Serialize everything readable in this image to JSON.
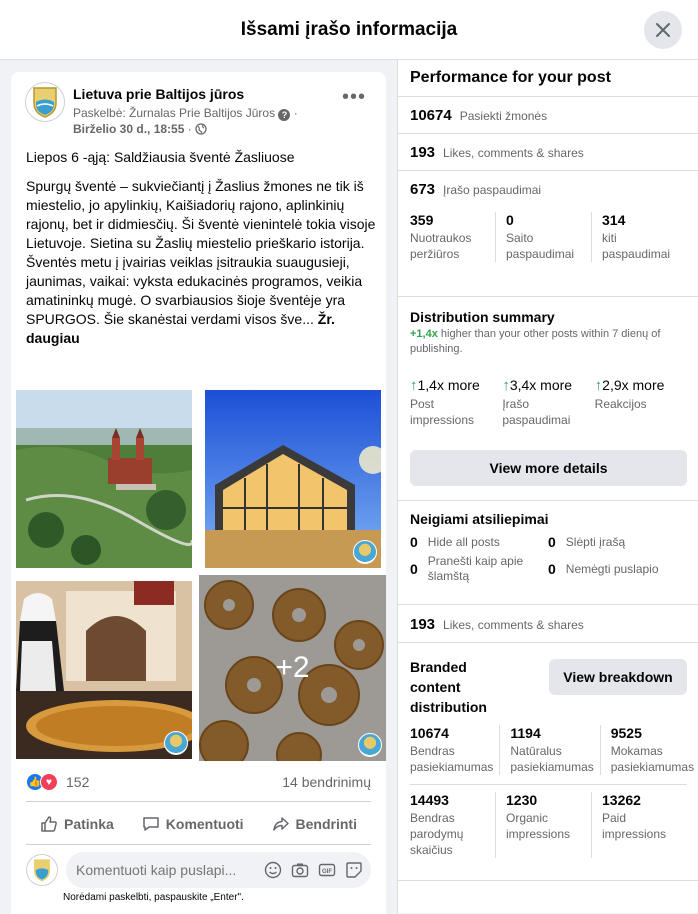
{
  "header": {
    "title": "Išsami įrašo informacija"
  },
  "post": {
    "page_name": "Lietuva prie Baltijos jūros",
    "posted_by": "Paskelbė: Žurnalas Prie Baltijos Jūros",
    "date": "Birželio 30 d., 18:55",
    "text_title": "Liepos 6 -ąją: Saldžiausia šventė Žasliuose",
    "text_body_1": "Spurgų šventė – sukviečiantį į Žaslius žmones ne tik iš miestelio, jo apylinkių, Kaišiadorių rajono, aplinkinių rajonų, bet ir didmiesčių. Ši šventė vienintelė tokia visoje Lietuvoje. Sietina su Žaslių miestelio prieškario istorija.",
    "text_body_2": "Šventės metu į įvairias veiklas įsitraukia suaugusieji, jaunimas, vaikai: vyksta edukacinės programos, veikia amatininkų mugė.  O svarbiausios šioje šventėje yra SPURGOS. Šie skanėstai verdami visos švе...",
    "see_more": "Žr. daugiau",
    "more_photos": "+2",
    "reaction_count": "152",
    "shares": "14 bendrinimų",
    "actions": {
      "like": "Patinka",
      "comment": "Komentuoti",
      "share": "Bendrinti"
    },
    "comment_placeholder": "Komentuoti kaip puslapi...",
    "comment_hint": "Norėdami paskelbti, paspauskite „Enter\"."
  },
  "performance": {
    "title": "Performance for your post",
    "reach": {
      "value": "10674",
      "label": "Pasiekti žmonės"
    },
    "engagement": {
      "value": "193",
      "label": "Likes, comments & shares"
    },
    "clicks": {
      "value": "673",
      "label": "Įrašo paspaudimai"
    },
    "click_breakdown": [
      {
        "value": "359",
        "label": "Nuotraukos peržiūros"
      },
      {
        "value": "0",
        "label": "Saito paspaudimai"
      },
      {
        "value": "314",
        "label": "kiti paspaudimai"
      }
    ]
  },
  "distribution": {
    "title": "Distribution summary",
    "highlight": "+1,4x",
    "subtitle": "higher than your other posts within 7 dienų of publishing.",
    "metrics": [
      {
        "value": "1,4x more",
        "label": "Post impressions"
      },
      {
        "value": "3,4x more",
        "label": "Įrašo paspaudimai"
      },
      {
        "value": "2,9x more",
        "label": "Reakcijos"
      }
    ],
    "button": "View more details"
  },
  "negative": {
    "title": "Neigiami atsiliepimai",
    "items": [
      {
        "value": "0",
        "label": "Hide all posts"
      },
      {
        "value": "0",
        "label": "Slėpti įrašą"
      },
      {
        "value": "0",
        "label": "Pranešti kaip apie šlamštą"
      },
      {
        "value": "0",
        "label": "Nemėgti puslapio"
      }
    ]
  },
  "engagement2": {
    "value": "193",
    "label": "Likes, comments & shares"
  },
  "branded": {
    "title": "Branded content distribution",
    "button": "View breakdown",
    "row1": [
      {
        "value": "10674",
        "label": "Bendras pasiekiamumas"
      },
      {
        "value": "1194",
        "label": "Natūralus pasiekiamumas"
      },
      {
        "value": "9525",
        "label": "Mokamas pasiekiamumas"
      }
    ],
    "row2": [
      {
        "value": "14493",
        "label": "Bendras parodymų skaičius"
      },
      {
        "value": "1230",
        "label": "Organic impressions"
      },
      {
        "value": "13262",
        "label": "Paid impressions"
      }
    ]
  },
  "colors": {
    "accent_blue": "#1877f2",
    "green": "#31a24c",
    "gray_bg": "#f0f2f5"
  }
}
